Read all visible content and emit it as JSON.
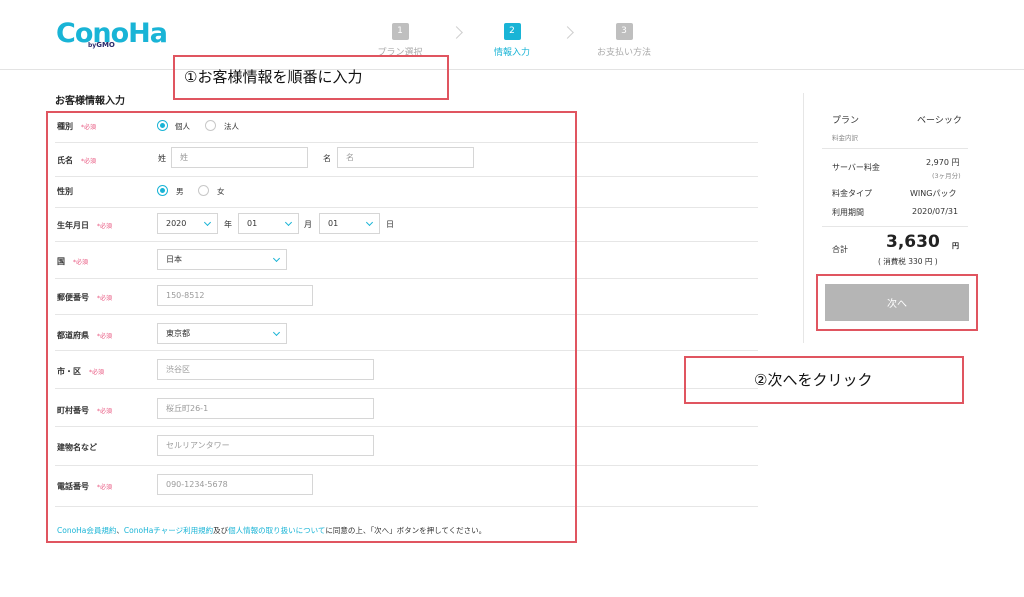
{
  "brand": {
    "logo_text": "ConoHa",
    "logo_sub_prefix": "by",
    "logo_sub_brand": "GMO"
  },
  "steps": [
    {
      "number": "1",
      "label": "プラン選択",
      "active": false
    },
    {
      "number": "2",
      "label": "情報入力",
      "active": true
    },
    {
      "number": "3",
      "label": "お支払い方法",
      "active": false
    }
  ],
  "annotations": {
    "step1": "①お客様情報を順番に入力",
    "step2": "②次へをクリック",
    "color": "#e05560"
  },
  "form": {
    "title": "お客様情報入力",
    "required_mark": "*必須",
    "type": {
      "label": "種別",
      "options": [
        {
          "label": "個人",
          "checked": true
        },
        {
          "label": "法人",
          "checked": false
        }
      ]
    },
    "name": {
      "label": "氏名",
      "last_prefix": "姓",
      "last_placeholder": "姓",
      "first_prefix": "名",
      "first_placeholder": "名"
    },
    "gender": {
      "label": "性別",
      "options": [
        {
          "label": "男",
          "checked": true
        },
        {
          "label": "女",
          "checked": false
        }
      ]
    },
    "birthdate": {
      "label": "生年月日",
      "year_value": "2020",
      "year_unit": "年",
      "month_value": "01",
      "month_unit": "月",
      "day_value": "01",
      "day_unit": "日"
    },
    "country": {
      "label": "国",
      "value": "日本"
    },
    "postal": {
      "label": "郵便番号",
      "placeholder": "150-8512"
    },
    "prefecture": {
      "label": "都道府県",
      "value": "東京都"
    },
    "city": {
      "label": "市・区",
      "placeholder": "渋谷区"
    },
    "town": {
      "label": "町村番号",
      "placeholder": "桜丘町26-1"
    },
    "building": {
      "label": "建物名など",
      "placeholder": "セルリアンタワー"
    },
    "phone": {
      "label": "電話番号",
      "placeholder": "090-1234-5678"
    },
    "consent": {
      "link1": "ConoHa会員規約",
      "sep1": "、",
      "link2": "ConoHaチャージ利用規約",
      "sep2": "及び",
      "link3": "個人情報の取り扱いについて",
      "rest": "に同意の上、「次へ」ボタンを押してください。"
    }
  },
  "summary": {
    "plan_label": "プラン",
    "plan_value": "ベーシック",
    "breakdown_label": "料金内訳",
    "server_fee_label": "サーバー料金",
    "server_fee_value": "2,970 円",
    "server_fee_note": "(3ヶ月分)",
    "fee_type_label": "料金タイプ",
    "fee_type_value": "WINGパック",
    "period_label": "利用期間",
    "period_value": "2020/07/31",
    "total_label": "合計",
    "total_value": "3,630",
    "total_unit": "円",
    "tax_note": "( 消費税 330 円 )",
    "next_button": "次へ"
  },
  "colors": {
    "accent": "#19b4d6",
    "required": "#e8547e",
    "button_disabled": "#b5b5b5"
  }
}
